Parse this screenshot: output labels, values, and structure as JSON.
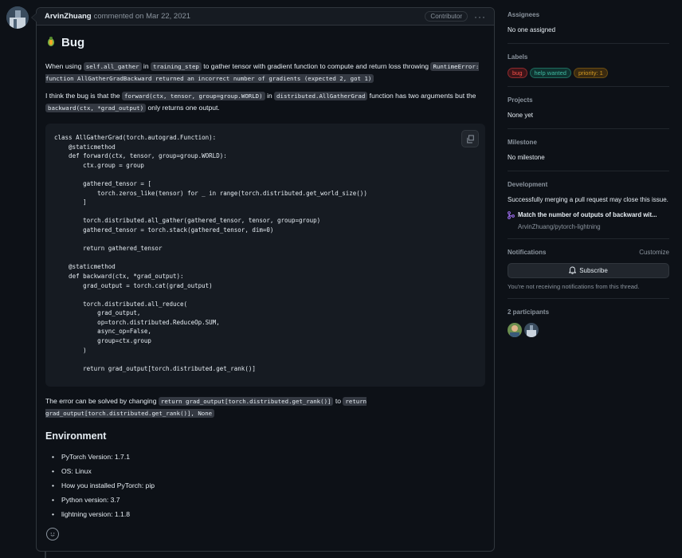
{
  "comment": {
    "author": "ArvinZhuang",
    "action": "commented on Mar 22, 2021",
    "badge": "Contributor",
    "more": "···",
    "title": "Bug",
    "p1_a": "When using ",
    "p1_code1": "self.all_gather",
    "p1_b": " in ",
    "p1_code2": "training_step",
    "p1_c": " to gather tensor with gradient function to compute and return loss throwing ",
    "p1_code3": "RuntimeError: function AllGatherGradBackward returned an incorrect number of gradients (expected 2, got 1)",
    "p2_a": "I think the bug is that the ",
    "p2_code1": "forward(ctx, tensor, group=group.WORLD)",
    "p2_b": " in ",
    "p2_code2": "distributed.AllGatherGrad",
    "p2_c": " function has two arguments but the ",
    "p2_code3": "backward(ctx, *grad_output)",
    "p2_d": " only returns one output.",
    "code": "class AllGatherGrad(torch.autograd.Function):\n    @staticmethod\n    def forward(ctx, tensor, group=group.WORLD):\n        ctx.group = group\n\n        gathered_tensor = [\n            torch.zeros_like(tensor) for _ in range(torch.distributed.get_world_size())\n        ]\n\n        torch.distributed.all_gather(gathered_tensor, tensor, group=group)\n        gathered_tensor = torch.stack(gathered_tensor, dim=0)\n\n        return gathered_tensor\n\n    @staticmethod\n    def backward(ctx, *grad_output):\n        grad_output = torch.cat(grad_output)\n\n        torch.distributed.all_reduce(\n            grad_output,\n            op=torch.distributed.ReduceOp.SUM,\n            async_op=False,\n            group=ctx.group\n        )\n\n        return grad_output[torch.distributed.get_rank()]",
    "p3_a": "The error can be solved by changing ",
    "p3_code1": "return grad_output[torch.distributed.get_rank()]",
    "p3_b": " to ",
    "p3_code2": "return grad_output[torch.distributed.get_rank()], None",
    "env_title": "Environment",
    "env_items": [
      "PyTorch Version: 1.7.1",
      "OS: Linux",
      "How you installed PyTorch: pip",
      "Python version: 3.7",
      "lightning version: 1.1.8"
    ]
  },
  "sidebar": {
    "assignees_title": "Assignees",
    "assignees_value": "No one assigned",
    "labels_title": "Labels",
    "labels": [
      {
        "text": "bug",
        "color": "#f85149",
        "bg": "#3d1418"
      },
      {
        "text": "help wanted",
        "color": "#3fb9a0",
        "bg": "#0f3330"
      },
      {
        "text": "priority: 1",
        "color": "#d29922",
        "bg": "#3a2a10"
      }
    ],
    "projects_title": "Projects",
    "projects_value": "None yet",
    "milestone_title": "Milestone",
    "milestone_value": "No milestone",
    "development_title": "Development",
    "development_text": "Successfully merging a pull request may close this issue.",
    "pr_title": "Match the number of outputs of backward wit...",
    "pr_repo": "ArvinZhuang/pytorch-lightning",
    "notifications_title": "Notifications",
    "customize": "Customize",
    "subscribe": "Subscribe",
    "notif_note": "You're not receiving notifications from this thread.",
    "participants_title": "2 participants"
  }
}
